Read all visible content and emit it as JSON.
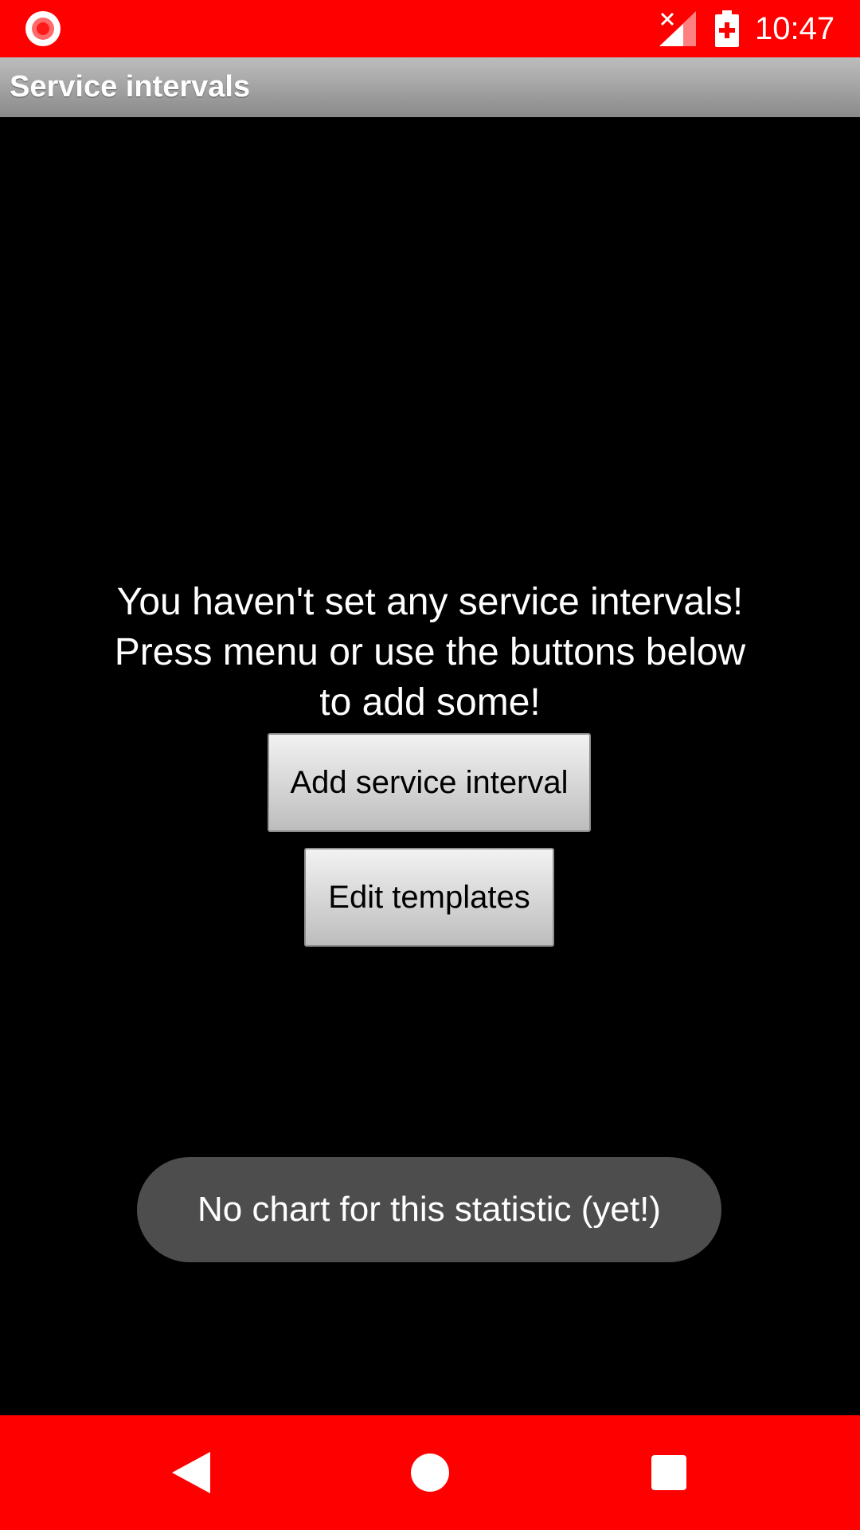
{
  "status_bar": {
    "time": "10:47",
    "background_color": "#ff0000",
    "icons": [
      "screen-record-icon",
      "signal-no-data-icon",
      "battery-charging-icon"
    ]
  },
  "app_bar": {
    "title": "Service intervals"
  },
  "main": {
    "empty_message": "You haven't set any service intervals!\nPress menu or use the buttons below\nto add some!",
    "add_button_label": "Add service interval",
    "edit_templates_label": "Edit templates"
  },
  "toast": {
    "text": "No chart for this statistic (yet!)"
  },
  "nav_bar": {
    "background_color": "#ff0000",
    "icons": [
      "back-icon",
      "home-icon",
      "recents-icon"
    ]
  }
}
